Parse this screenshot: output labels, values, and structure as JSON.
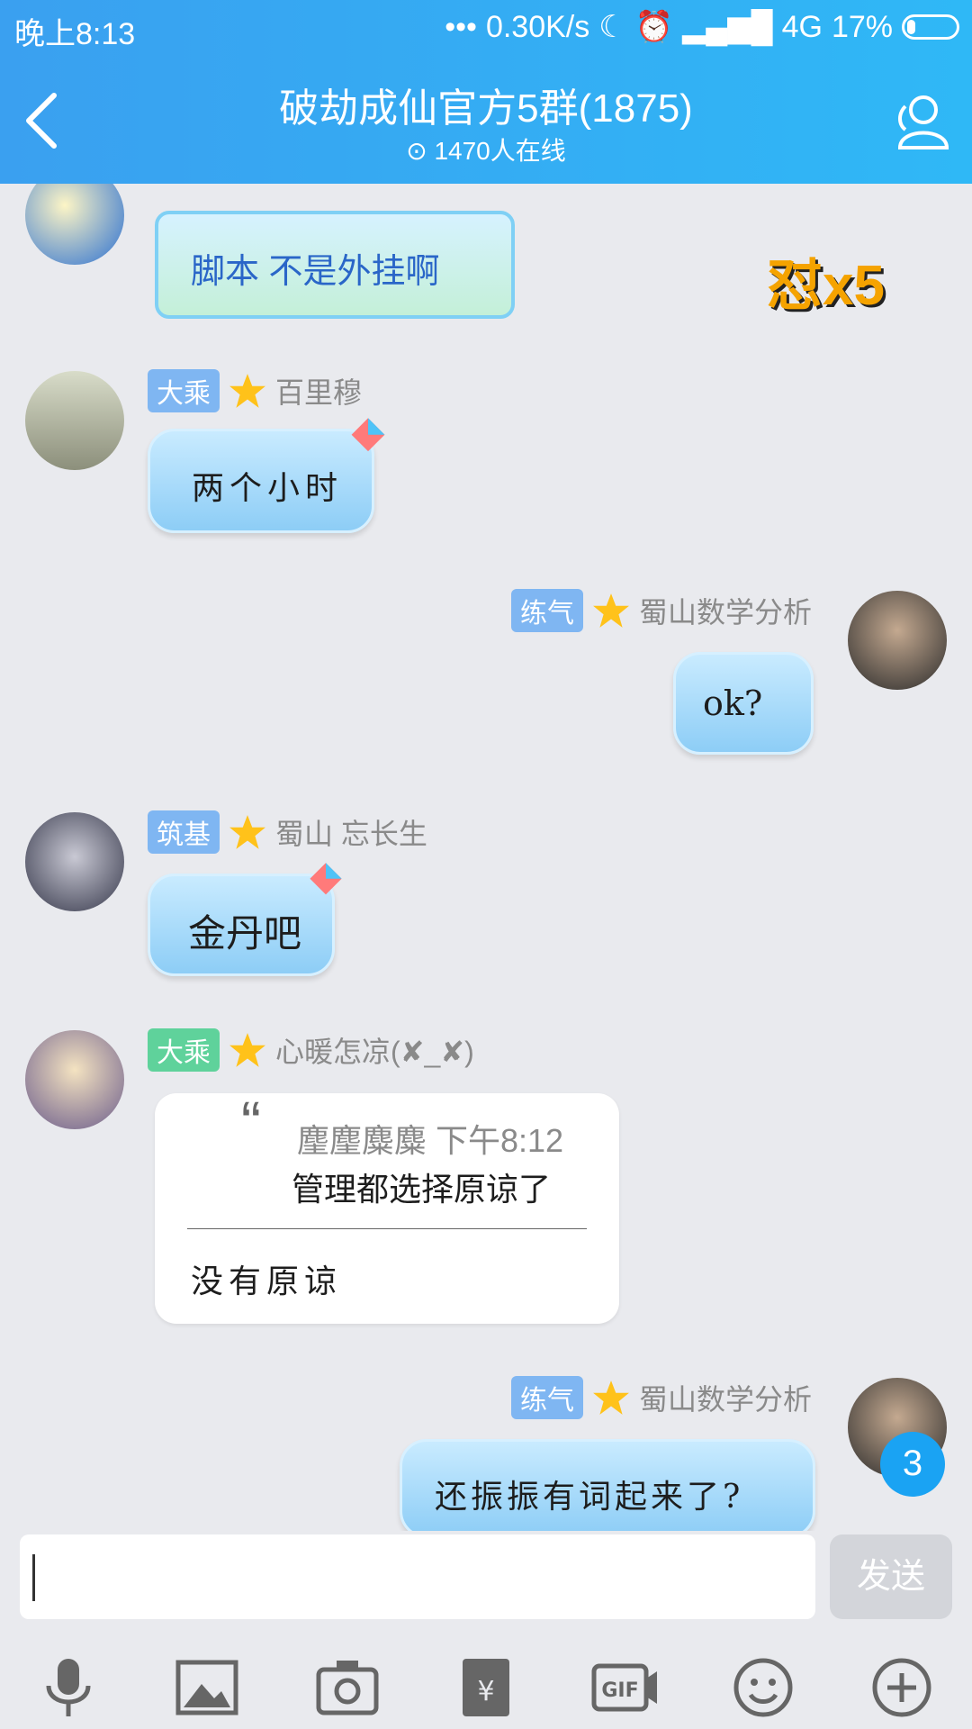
{
  "status_bar": {
    "time": "晚上8:13",
    "network_speed": "0.30K/s",
    "network_type": "4G",
    "battery": "17%",
    "battery_level": 0.17
  },
  "header": {
    "title": "破劫成仙官方5群(1875)",
    "online": "1470人在线"
  },
  "colors": {
    "header": "#2fb8f6",
    "badge_dacheng": "#5fd29b",
    "badge_blue": "#7fb6f2",
    "accent": "#1aa3f3"
  },
  "messages": [
    {
      "text": "脚本 不是外挂啊",
      "sticker": "怼x5"
    },
    {
      "badge": "大乘",
      "name": "百里穆",
      "text": "两个小时"
    },
    {
      "badge": "练气",
      "name": "蜀山数学分析",
      "text": "ok?"
    },
    {
      "badge": "筑基",
      "name": "蜀山 忘长生",
      "text": "金丹吧"
    },
    {
      "badge": "大乘",
      "name": "心暖怎凉(✘_✘)",
      "quote_author": "麈麈麋麋 下午8:12",
      "quote_text": "管理都选择原谅了",
      "text": "没有原谅"
    },
    {
      "badge": "练气",
      "name": "蜀山数学分析",
      "text": "还振振有词起来了?"
    }
  ],
  "unread_count": "3",
  "input": {
    "placeholder": "",
    "send_label": "发送"
  },
  "toolbar": [
    "mic-icon",
    "image-icon",
    "camera-icon",
    "red-packet-icon",
    "gif-icon",
    "emoji-icon",
    "plus-icon"
  ]
}
